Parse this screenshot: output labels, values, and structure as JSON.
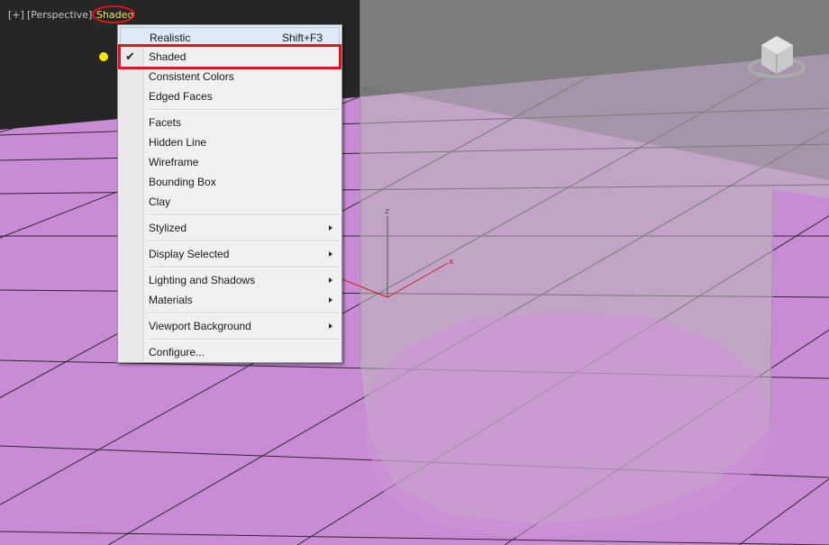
{
  "viewport": {
    "label_plus": "[+]",
    "label_view": "[Perspective]",
    "label_shading": "Shaded",
    "colors": {
      "ground": "#c98bd6",
      "grid_line": "#2a2a2a",
      "background": "#262626",
      "accent_red": "#e0141e",
      "shading_label": "#f0e060"
    },
    "gizmo_axes": [
      "z",
      "x"
    ],
    "viewcube_icon": "viewcube-icon"
  },
  "menu": {
    "items": [
      {
        "label": "Realistic",
        "shortcut": "Shift+F3",
        "highlighted": true
      },
      {
        "label": "Shaded",
        "checked": true
      },
      {
        "label": "Consistent Colors"
      },
      {
        "label": "Edged Faces"
      },
      {
        "label": "Facets"
      },
      {
        "label": "Hidden Line"
      },
      {
        "label": "Wireframe"
      },
      {
        "label": "Bounding Box"
      },
      {
        "label": "Clay"
      },
      {
        "label": "Stylized",
        "submenu": true
      },
      {
        "label": "Display Selected",
        "submenu": true
      },
      {
        "label": "Lighting and Shadows",
        "submenu": true
      },
      {
        "label": "Materials",
        "submenu": true
      },
      {
        "label": "Viewport Background",
        "submenu": true
      },
      {
        "label": "Configure..."
      }
    ]
  }
}
